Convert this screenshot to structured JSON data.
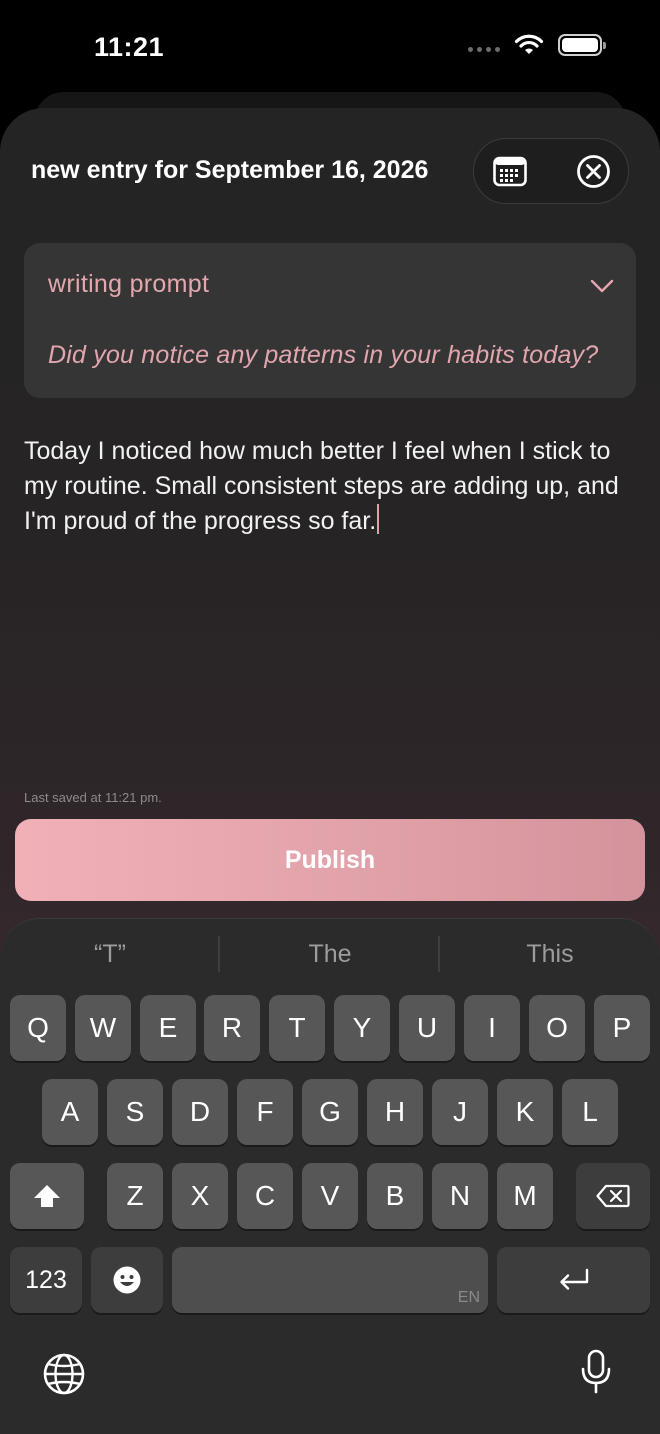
{
  "status_bar": {
    "time": "11:21"
  },
  "header": {
    "title": "new entry for September 16, 2026"
  },
  "prompt": {
    "label": "writing prompt",
    "question": "Did you notice any patterns in your habits today?"
  },
  "entry": {
    "text": "Today I noticed how much better I feel when I stick to my routine. Small consistent steps are adding up, and I'm proud of the progress so far."
  },
  "last_saved": "Last saved at 11:21 pm.",
  "publish_label": "Publish",
  "keyboard": {
    "suggestions": [
      "“T”",
      "The",
      "This"
    ],
    "row1": [
      "Q",
      "W",
      "E",
      "R",
      "T",
      "Y",
      "U",
      "I",
      "O",
      "P"
    ],
    "row2": [
      "A",
      "S",
      "D",
      "F",
      "G",
      "H",
      "J",
      "K",
      "L"
    ],
    "row3": [
      "Z",
      "X",
      "C",
      "V",
      "B",
      "N",
      "M"
    ],
    "numbers_key": "123",
    "space_lang": "EN"
  },
  "colors": {
    "accent": "#e3a7ad",
    "publish_start": "#f0b0b7",
    "publish_end": "#d3939c"
  }
}
